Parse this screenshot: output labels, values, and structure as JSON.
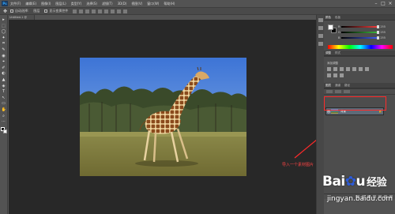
{
  "menubar": {
    "logo": "Ps",
    "items": [
      "文件(F)",
      "编辑(E)",
      "图像(I)",
      "图层(L)",
      "类型(Y)",
      "选择(S)",
      "滤镜(T)",
      "3D(D)",
      "视图(V)",
      "窗口(W)",
      "帮助(H)"
    ],
    "window_controls": [
      "–",
      "□",
      "×"
    ]
  },
  "optionsbar": {
    "auto_select_label": "自动选择:",
    "layer_option": "图层",
    "transform_label": "显示变换控件"
  },
  "document": {
    "tab_title": "Untitled-1 @ 66.7%"
  },
  "toolbar": {
    "tools": [
      "▸",
      "⬚",
      "◯",
      "✦",
      "⌗",
      "✎",
      "◉",
      "⌖",
      "✐",
      "◐",
      "▲",
      "◈",
      "T",
      "↖",
      "▭",
      "✋",
      "⌕",
      "⋯"
    ]
  },
  "panels": {
    "color_tabs": [
      "颜色",
      "色板"
    ],
    "color_sliders": [
      {
        "label": "R",
        "value": "255",
        "color": "#ff4040",
        "fraction": 1.0
      },
      {
        "label": "G",
        "value": "255",
        "color": "#40c040",
        "fraction": 1.0
      },
      {
        "label": "B",
        "value": "255",
        "color": "#4060ff",
        "fraction": 1.0
      }
    ],
    "adjust_tabs": [
      "调整",
      "样式"
    ],
    "adjust_title": "添加调整",
    "layers_tabs": [
      "图层",
      "通道",
      "路径"
    ],
    "layer": {
      "name": "背景",
      "eye": "👁",
      "lock": "🔒"
    }
  },
  "annotation": {
    "text": "导入一个素材图片",
    "color": "#ff2a2a"
  },
  "watermark": {
    "brand": "Bai",
    "paw": "✿",
    "brand_end": "u",
    "cn": "经验",
    "url": "jingyan.baidu.com"
  },
  "colors": {
    "ui_bg": "#535353",
    "canvas_bg": "#282828",
    "highlight": "#ff2a2a",
    "sky": "#4f86d8"
  }
}
